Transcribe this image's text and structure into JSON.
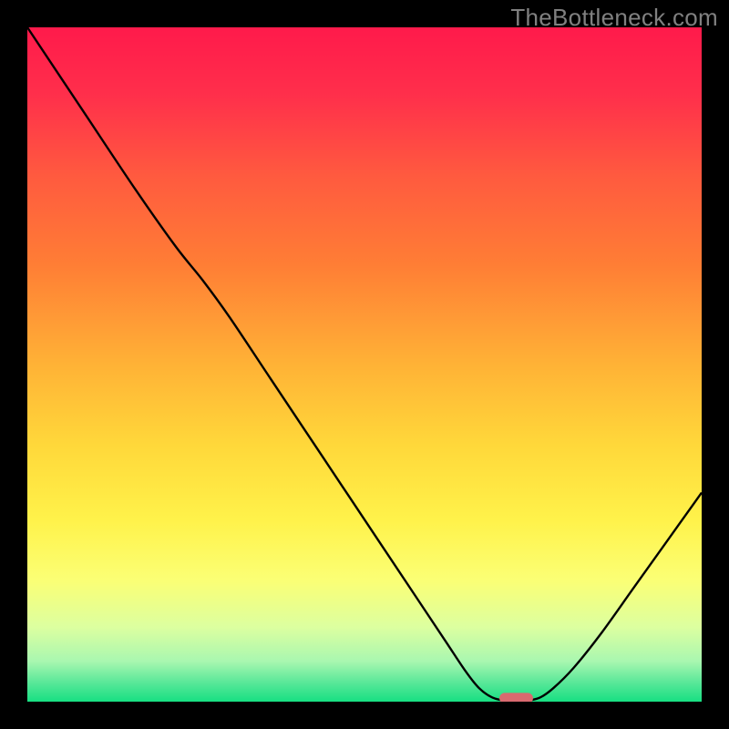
{
  "watermark": "TheBottleneck.com",
  "chart_data": {
    "type": "line",
    "title": "",
    "xlabel": "",
    "ylabel": "",
    "xlim": [
      0,
      100
    ],
    "ylim": [
      0,
      100
    ],
    "background_gradient": {
      "stops": [
        {
          "offset": 0,
          "color": "#ff1a4b"
        },
        {
          "offset": 10,
          "color": "#ff2f4b"
        },
        {
          "offset": 22,
          "color": "#ff5a3f"
        },
        {
          "offset": 35,
          "color": "#ff7d35"
        },
        {
          "offset": 50,
          "color": "#ffb236"
        },
        {
          "offset": 62,
          "color": "#ffd83a"
        },
        {
          "offset": 73,
          "color": "#fff24a"
        },
        {
          "offset": 82,
          "color": "#fbff75"
        },
        {
          "offset": 89,
          "color": "#dcffa0"
        },
        {
          "offset": 94,
          "color": "#a9f7b0"
        },
        {
          "offset": 97,
          "color": "#5de89a"
        },
        {
          "offset": 100,
          "color": "#17df82"
        }
      ]
    },
    "curve": [
      {
        "x": 0.0,
        "y": 100.0
      },
      {
        "x": 8.0,
        "y": 88.0
      },
      {
        "x": 16.0,
        "y": 76.0
      },
      {
        "x": 22.0,
        "y": 67.5
      },
      {
        "x": 26.0,
        "y": 62.5
      },
      {
        "x": 30.0,
        "y": 57.0
      },
      {
        "x": 36.0,
        "y": 48.0
      },
      {
        "x": 44.0,
        "y": 36.0
      },
      {
        "x": 52.0,
        "y": 24.0
      },
      {
        "x": 58.0,
        "y": 15.0
      },
      {
        "x": 62.0,
        "y": 9.0
      },
      {
        "x": 65.0,
        "y": 4.5
      },
      {
        "x": 67.0,
        "y": 2.0
      },
      {
        "x": 69.0,
        "y": 0.6
      },
      {
        "x": 71.0,
        "y": 0.2
      },
      {
        "x": 74.0,
        "y": 0.2
      },
      {
        "x": 76.0,
        "y": 0.6
      },
      {
        "x": 78.0,
        "y": 2.0
      },
      {
        "x": 81.0,
        "y": 5.0
      },
      {
        "x": 85.0,
        "y": 10.0
      },
      {
        "x": 90.0,
        "y": 17.0
      },
      {
        "x": 95.0,
        "y": 24.0
      },
      {
        "x": 100.0,
        "y": 31.0
      }
    ],
    "marker": {
      "x": 72.5,
      "y": 0.5,
      "width": 5.0,
      "height": 1.6,
      "color": "#d96a6f"
    },
    "border_color": "#000000"
  }
}
